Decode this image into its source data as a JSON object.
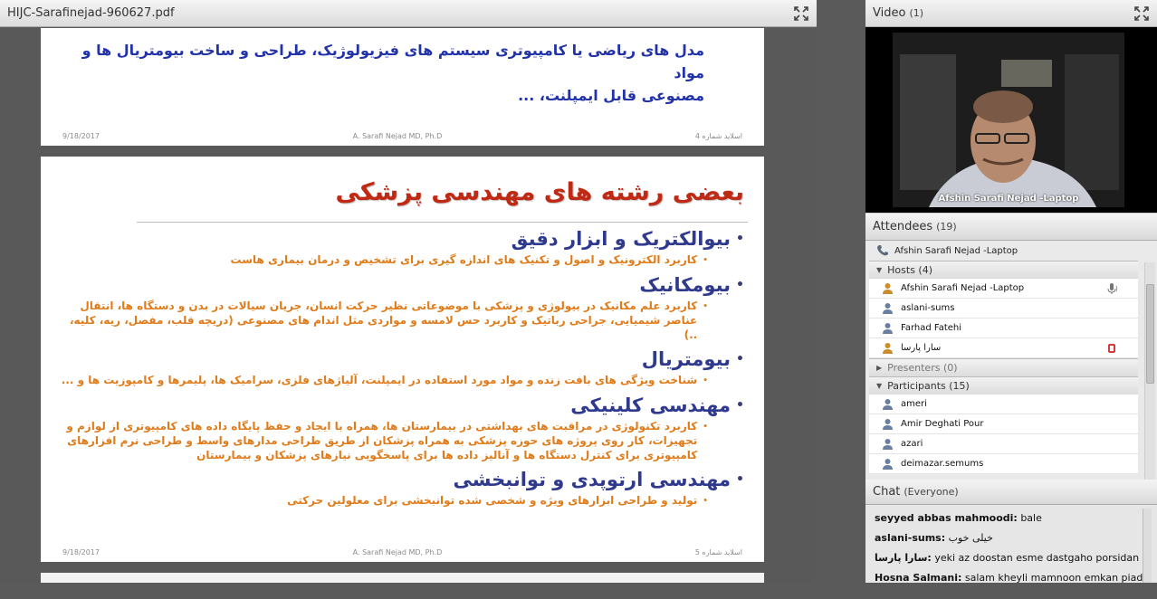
{
  "share_pod": {
    "title": "HIJC-Sarafinejad-960627.pdf",
    "expand_icon": "expand-arrows-icon"
  },
  "slide4": {
    "line1": "مدل های ریاضی یا کامپیوتری سیستم های فیزیولوژیک، طراحی و ساخت بیومتریال ها و مواد",
    "line2": "مصنوعی قابل ایمپلنت، ...",
    "footer_date": "9/18/2017",
    "footer_author": "A. Sarafi Nejad MD, Ph.D",
    "footer_page": "اسلاید شماره 4"
  },
  "slide5": {
    "title": "بعضی رشته های مهندسی پزشکی",
    "topics": [
      {
        "head": "بیوالکتریک و ابزار دقیق",
        "sub": "کاربرد الکترونیک و اصول و تکنیک های اندازه گیری برای تشخیص و درمان بیماری هاست"
      },
      {
        "head": "بیومکانیک",
        "sub": "کاربرد علم مکانیک در بیولوژی و پزشکی با موضوعاتی نظیر حرکت انسان، جریان سیالات در بدن و دستگاه ها، انتقال عناصر شیمیایی، جراحی رباتیک و کاربرد حس لامسه و مواردی مثل اندام های مصنوعی (دریچه قلب، مفصل، ریه، کلیه، ..)"
      },
      {
        "head": "بیومتریال",
        "sub": "شناخت ویژگی های بافت زنده و مواد مورد استفاده در ایمپلنت، آلیاژهای فلزی، سرامیک ها، پلیمرها و کامپوزیت ها و ..."
      },
      {
        "head": "مهندسی کلینیکی",
        "sub": "کاربرد تکنولوژی در مراقبت های بهداشتی در بیمارستان ها، همراه با ایجاد و حفظ پایگاه داده های کامپیوتری از لوازم و تجهیزات، کار روی پروژه های حوزه پزشکی به همراه پزشکان از طریق طراحی مدارهای واسط و طراحی نرم افزارهای کامپیوتری برای کنترل دستگاه ها و آنالیز داده ها برای پاسخگویی نیازهای پزشکان و بیمارستان"
      },
      {
        "head": "مهندسی ارتوپدی و توانبخشی",
        "sub": "تولید و طراحی ابزارهای ویژه و شخصی شده توانبخشی برای معلولین حرکتی"
      }
    ],
    "footer_date": "9/18/2017",
    "footer_author": "A. Sarafi Nejad MD, Ph.D",
    "footer_page": "اسلاید شماره 5"
  },
  "video_pod": {
    "title": "Video",
    "count": "(1)",
    "speaker_name": "Afshin Sarafi Nejad -Laptop"
  },
  "attendees_pod": {
    "title": "Attendees",
    "count": "(19)",
    "current_user": "Afshin Sarafi Nejad -Laptop",
    "hosts_label": "Hosts (4)",
    "hosts": [
      {
        "name": "Afshin Sarafi Nejad -Laptop",
        "status_icon": "microphone-icon"
      },
      {
        "name": "aslani-sums",
        "status_icon": ""
      },
      {
        "name": "Farhad Fatehi",
        "status_icon": ""
      },
      {
        "name": "سارا پارسا",
        "status_icon": "raised-hand-icon"
      }
    ],
    "presenters_label": "Presenters (0)",
    "participants_label": "Participants (15)",
    "participants": [
      {
        "name": "ameri"
      },
      {
        "name": "Amir Deghati Pour"
      },
      {
        "name": "azari"
      },
      {
        "name": "deimazar.semums"
      }
    ]
  },
  "chat_pod": {
    "title": "Chat",
    "scope": "(Everyone)",
    "messages": [
      {
        "sender": "seyyed abbas mahmoodi:",
        "text": "bale"
      },
      {
        "sender": "aslani-sums:",
        "text": "خیلی خوب"
      },
      {
        "sender": "سارا پارسا:",
        "text": "yeki az doostan esme dastgaho porsidan"
      },
      {
        "sender": "Hosna Salmani:",
        "text": "salam kheyli mamnoon emkan piade sazi"
      }
    ]
  },
  "colors": {
    "slide_title": "#c02a14",
    "topic_head": "#2f3a8f",
    "topic_sub": "#e07b1a",
    "slide4_text": "#2233aa"
  }
}
